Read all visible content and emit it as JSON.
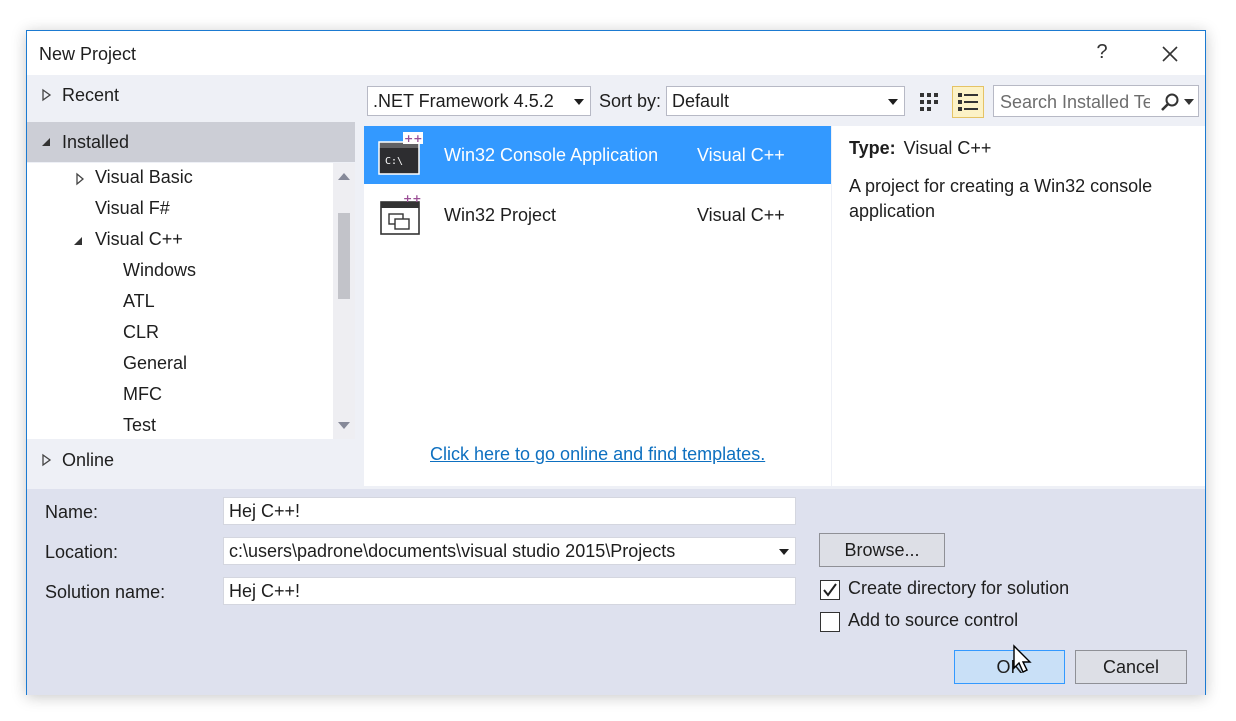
{
  "window": {
    "title": "New Project",
    "help": "?"
  },
  "tree": {
    "recent": "Recent",
    "installed": "Installed",
    "online": "Online",
    "items": [
      {
        "label": "Visual Basic",
        "arrow": "collapsed"
      },
      {
        "label": "Visual F#",
        "arrow": "none"
      },
      {
        "label": "Visual C++",
        "arrow": "expanded"
      },
      {
        "label": "Windows",
        "arrow": "none"
      },
      {
        "label": "ATL",
        "arrow": "none"
      },
      {
        "label": "CLR",
        "arrow": "none"
      },
      {
        "label": "General",
        "arrow": "none"
      },
      {
        "label": "MFC",
        "arrow": "none"
      },
      {
        "label": "Test",
        "arrow": "none"
      }
    ]
  },
  "toolbar": {
    "framework": ".NET Framework 4.5.2",
    "sort_label": "Sort by:",
    "sort_value": "Default",
    "search_placeholder": "Search Installed Templates"
  },
  "templates": [
    {
      "name": "Win32 Console Application",
      "language": "Visual C++",
      "selected": true,
      "icon": "console-app-icon"
    },
    {
      "name": "Win32 Project",
      "language": "Visual C++",
      "selected": false,
      "icon": "win32-project-icon"
    }
  ],
  "online_link": "Click here to go online and find templates.",
  "description": {
    "type_label": "Type:",
    "type_value": "Visual C++",
    "text": "A project for creating a Win32 console application"
  },
  "form": {
    "name_label": "Name:",
    "name_value": "Hej C++!",
    "location_label": "Location:",
    "location_value": "c:\\users\\padrone\\documents\\visual studio 2015\\Projects",
    "solution_label": "Solution name:",
    "solution_value": "Hej C++!",
    "browse": "Browse...",
    "create_dir": "Create directory for solution",
    "create_dir_checked": true,
    "source_control": "Add to source control",
    "source_control_checked": false,
    "ok": "OK",
    "cancel": "Cancel"
  },
  "colors": {
    "accent": "#3399ff",
    "link": "#0e70c0",
    "border": "#1b7ad1"
  }
}
